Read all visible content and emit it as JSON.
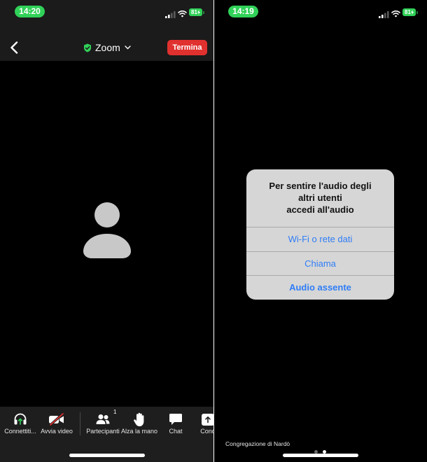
{
  "left_screen": {
    "status_bar": {
      "time": "14:20",
      "battery": "81",
      "icons": [
        "signal-icon",
        "wifi-icon",
        "battery-charging-icon"
      ]
    },
    "header": {
      "back_icon": "chevron-left-icon",
      "title": "Zoom",
      "title_icon": "shield-check-icon",
      "title_dropdown_icon": "chevron-down-icon",
      "end_button_label": "Termina"
    },
    "video_area": {
      "avatar_icon": "person-silhouette-icon"
    },
    "toolbar": {
      "items": [
        {
          "label": "Connettiti...",
          "icon": "headphones-icon"
        },
        {
          "label": "Avvia video",
          "icon": "video-off-icon"
        },
        {
          "label": "Partecipanti",
          "icon": "participants-icon",
          "badge": "1"
        },
        {
          "label": "Alza la mano",
          "icon": "raise-hand-icon"
        },
        {
          "label": "Chat",
          "icon": "chat-icon"
        },
        {
          "label": "Cond",
          "icon": "share-screen-icon"
        }
      ]
    }
  },
  "right_screen": {
    "status_bar": {
      "time": "14:19",
      "battery": "81",
      "icons": [
        "signal-icon",
        "wifi-icon",
        "battery-charging-icon"
      ]
    },
    "audio_dialog": {
      "title_lines": [
        "Per sentire l'audio degli",
        "altri utenti",
        "accedi all'audio"
      ],
      "options": [
        {
          "label": "Wi-Fi o rete dati",
          "emphasis": false
        },
        {
          "label": "Chiama",
          "emphasis": false
        },
        {
          "label": "Audio assente",
          "emphasis": true
        }
      ]
    },
    "footer": {
      "meeting_name": "Congregazione di Nardò",
      "page_indicator": {
        "pages": 2,
        "current": 2
      }
    }
  },
  "colors": {
    "status_green": "#30d158",
    "end_red": "#e0312f",
    "link_blue": "#2f7df6",
    "header_bg": "#1b1b1b",
    "toolbar_bg": "#1e1e1e",
    "dialog_bg": "#d6d6d6",
    "avatar_gray": "#c8c8c8"
  }
}
